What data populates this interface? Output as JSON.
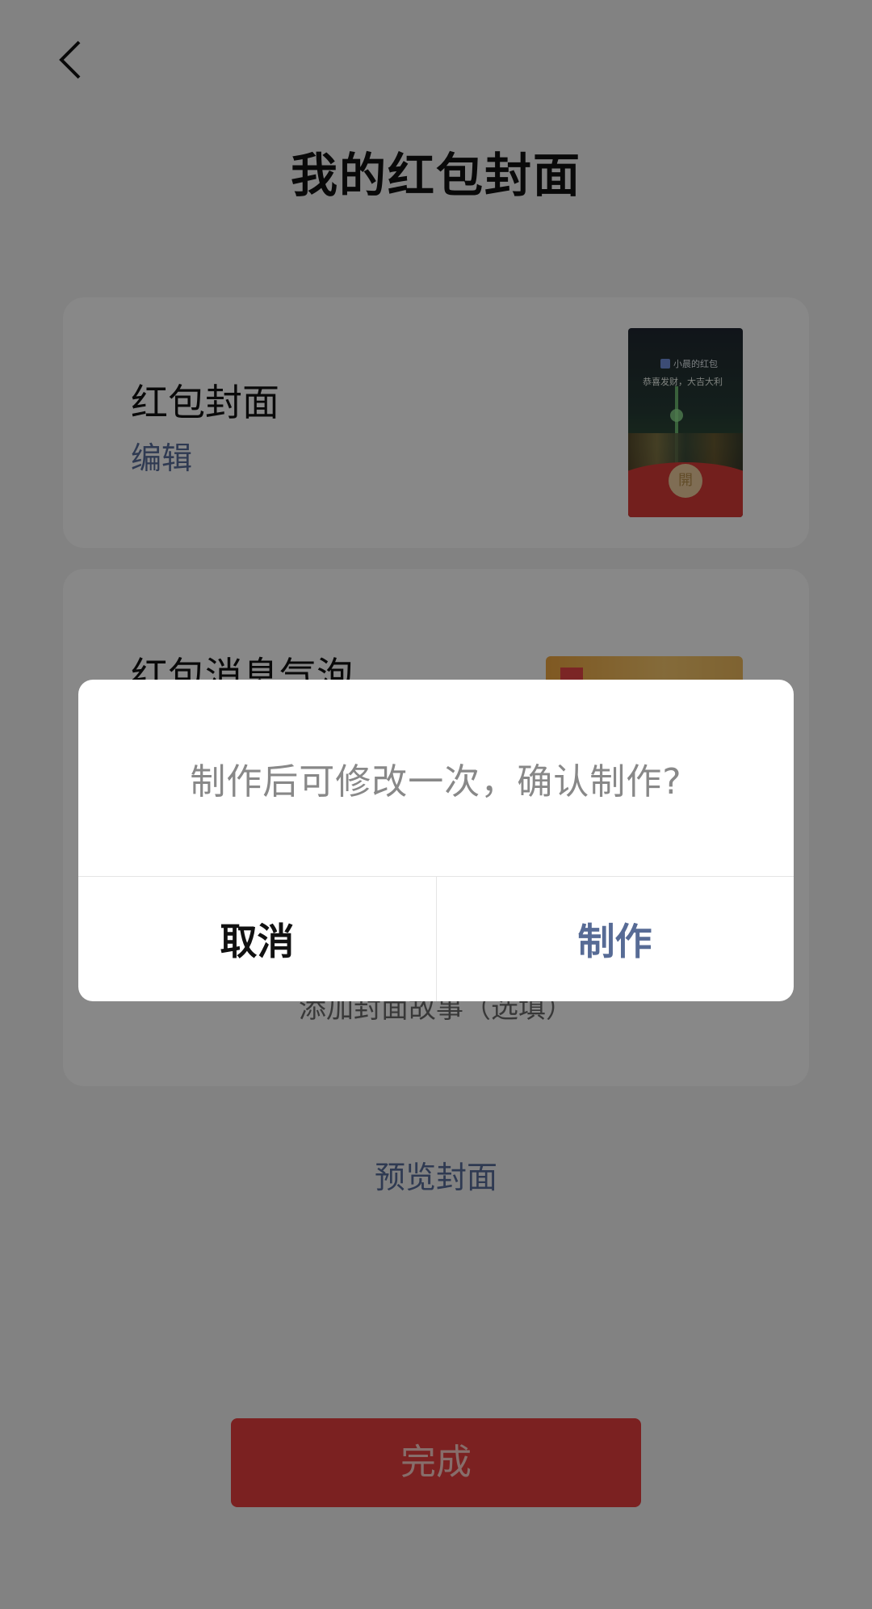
{
  "header": {
    "title": "我的红包封面"
  },
  "cover_card": {
    "title": "红包封面",
    "edit_label": "编辑",
    "thumb_brand": "小晨的红包",
    "thumb_greeting": "恭喜发财，大吉大利",
    "thumb_seal": "開"
  },
  "bubble_card": {
    "title": "红包消息气泡",
    "story_label": "添加封面故事（选填）"
  },
  "preview_label": "预览封面",
  "done_label": "完成",
  "dialog": {
    "message": "制作后可修改一次，确认制作?",
    "cancel_label": "取消",
    "confirm_label": "制作"
  },
  "colors": {
    "accent_red": "#e03c3c",
    "link_blue": "#576b95"
  }
}
